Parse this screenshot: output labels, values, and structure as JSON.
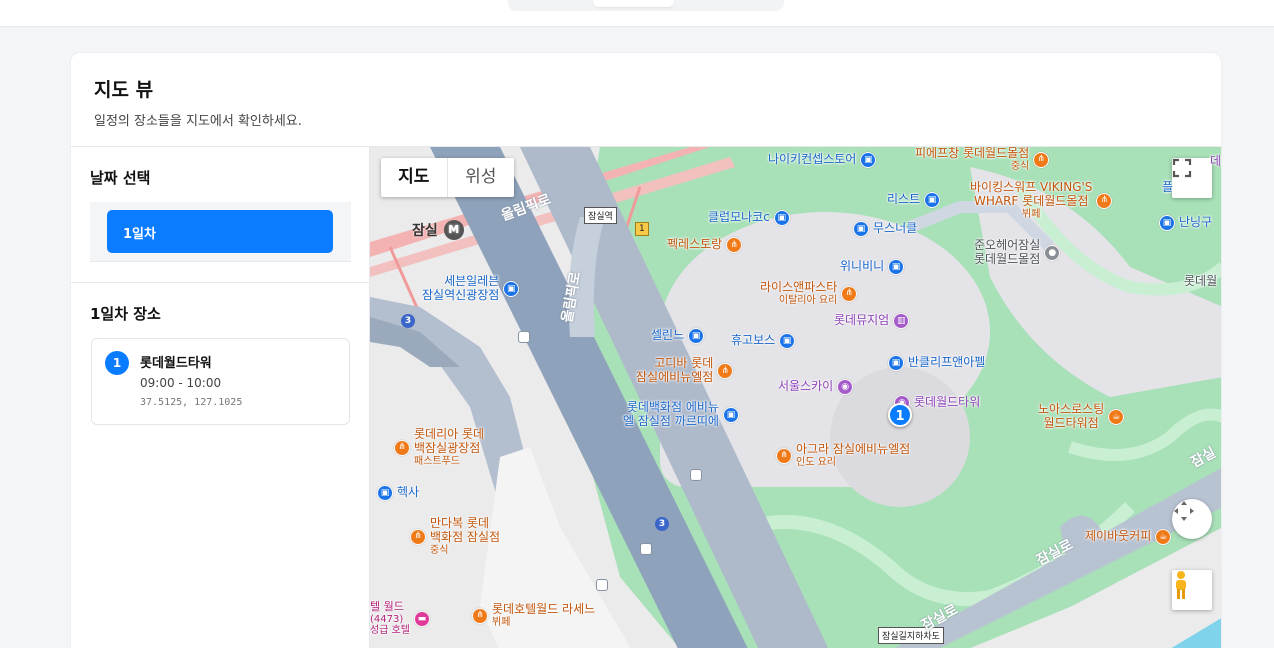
{
  "page": {
    "title": "지도 뷰",
    "subtitle": "일정의 장소들을 지도에서 확인하세요."
  },
  "sidebar": {
    "date_heading": "날짜 선택",
    "days": [
      {
        "label": "1일차",
        "selected": true
      }
    ],
    "places_heading": "1일차 장소",
    "places": [
      {
        "order": "1",
        "name": "롯데월드타워",
        "time": "09:00 - 10:00",
        "coords": "37.5125, 127.1025"
      }
    ]
  },
  "map": {
    "type_toggle": {
      "map_label": "지도",
      "satellite_label": "위성",
      "active": "지도"
    },
    "marker_label": "1",
    "station": {
      "name": "잠실",
      "badge": "M"
    },
    "tags": {
      "exit": "잠실역",
      "exit_num": "1",
      "underpass": "잠실길지하차도"
    },
    "road_labels": [
      "올림픽로",
      "올림픽로",
      "잠실로",
      "잠실로",
      "잠실"
    ],
    "line_badge": "3",
    "pois": {
      "nike": "나이키컨셉스토어",
      "fefe": "피에프창 롯데월드몰점",
      "fefe_sub": "중식",
      "viking1": "바이킹스워프 VIKING'S",
      "viking2": "WHARF 롯데월드몰점",
      "viking_sub": "뷔페",
      "list": "리스트",
      "club": "클럽모나코c",
      "musinsa": "무스너클",
      "junohair1": "준오헤어잠실",
      "junohair2": "롯데월드몰점",
      "pexel": "펙레스토랑",
      "winnie": "위니비니",
      "seven1": "세븐일레븐",
      "seven2": "잠실역신광장점",
      "rice": "라이스앤파스타",
      "rice_sub": "이탈리아 요리",
      "museum": "롯데뮤지엄",
      "celine": "셀린느",
      "hugo": "휴고보스",
      "cleef": "반클리프앤아펠",
      "godiva1": "고디바 롯데",
      "godiva2": "잠실에비뉴엘점",
      "seoulsky": "서울스카이",
      "tower": "롯데월드타워",
      "noa1": "노아스로스팅",
      "noa2": "월드타워점",
      "avenue1": "롯데백화점 에비뉴",
      "avenue2": "엘 잠실점 까르띠에",
      "agra": "아그라 잠실에비뉴엘점",
      "agra_sub": "인도 요리",
      "lotteria1": "롯데리아 롯데",
      "lotteria2": "백잠실광장점",
      "lotteria_sub": "패스트푸드",
      "hexa": "헥사",
      "mandabok1": "만다복 롯데",
      "mandabok2": "백화점 잠실점",
      "mandabok_sub": "중식",
      "hotel_buffet": "롯데호텔월드 라세느",
      "hotel_buffet_sub": "뷔페",
      "hotel1": "텔 월드",
      "hotel2": "(4473)",
      "hotel3": "성급 호텔",
      "jeilbak": "제이바웃커피",
      "nanning": "난닝구",
      "lotte_right": "롯데월",
      "edge1": "데",
      "edge2": "플"
    }
  }
}
